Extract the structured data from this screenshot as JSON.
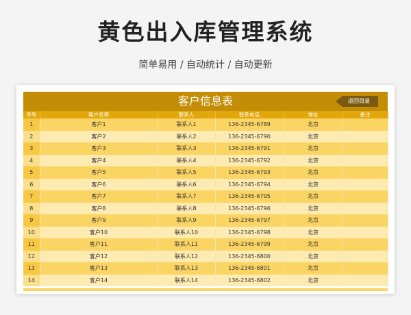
{
  "header": {
    "title": "黄色出入库管理系统",
    "subtitle": "简单易用  /  自动统计  /  自动更新"
  },
  "sheet": {
    "title": "客户信息表",
    "back_button": "返回目录",
    "columns": [
      "序号",
      "客户名称",
      "联系人",
      "联系电话",
      "地址",
      "备注"
    ],
    "rows": [
      [
        "1",
        "客户1",
        "联系人1",
        "136-2345-6789",
        "北京",
        ""
      ],
      [
        "2",
        "客户2",
        "联系人2",
        "136-2345-6790",
        "北京",
        ""
      ],
      [
        "3",
        "客户3",
        "联系人3",
        "136-2345-6791",
        "北京",
        ""
      ],
      [
        "4",
        "客户4",
        "联系人4",
        "136-2345-6792",
        "北京",
        ""
      ],
      [
        "5",
        "客户5",
        "联系人5",
        "136-2345-6793",
        "北京",
        ""
      ],
      [
        "6",
        "客户6",
        "联系人6",
        "136-2345-6794",
        "北京",
        ""
      ],
      [
        "7",
        "客户7",
        "联系人7",
        "136-2345-6795",
        "北京",
        ""
      ],
      [
        "8",
        "客户8",
        "联系人8",
        "136-2345-6796",
        "北京",
        ""
      ],
      [
        "9",
        "客户9",
        "联系人9",
        "136-2345-6797",
        "北京",
        ""
      ],
      [
        "10",
        "客户10",
        "联系人10",
        "136-2345-6798",
        "北京",
        ""
      ],
      [
        "11",
        "客户11",
        "联系人11",
        "136-2345-6799",
        "北京",
        ""
      ],
      [
        "12",
        "客户12",
        "联系人12",
        "136-2345-6800",
        "北京",
        ""
      ],
      [
        "13",
        "客户13",
        "联系人13",
        "136-2345-6801",
        "北京",
        ""
      ],
      [
        "14",
        "客户14",
        "联系人14",
        "136-2345-6802",
        "北京",
        ""
      ]
    ]
  },
  "colors": {
    "banner": "#c48d06",
    "header_row": "#e1a70d",
    "row_odd": "#fbd563",
    "row_even": "#fdebb2",
    "back_button": "#7a5a0e"
  }
}
